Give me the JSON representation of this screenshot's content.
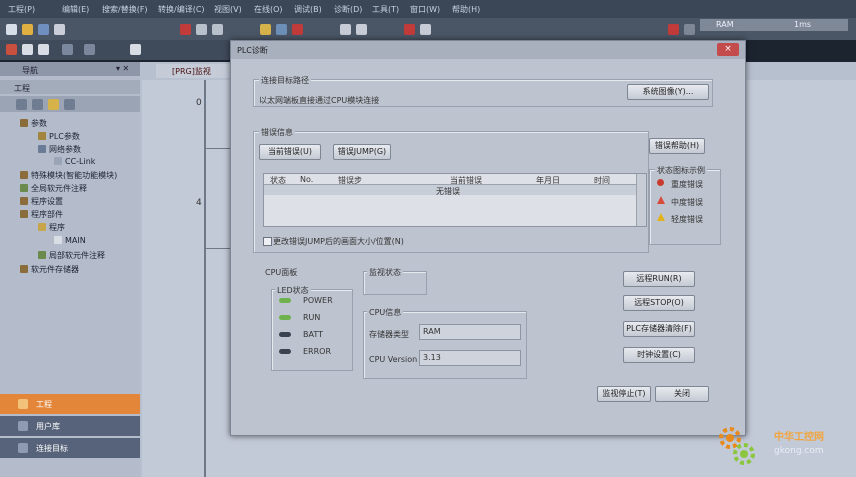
{
  "menu": [
    "工程(P)",
    "编辑(E)",
    "搜索/替换(F)",
    "转换/编译(C)",
    "视图(V)",
    "在线(O)",
    "调试(B)",
    "诊断(D)",
    "工具(T)",
    "窗口(W)",
    "帮助(H)"
  ],
  "status_fields": {
    "memory": "RAM",
    "time": "1ms"
  },
  "navigation": {
    "title": "导航",
    "project_label": "工程",
    "tree": [
      {
        "label": "参数",
        "level": 0
      },
      {
        "label": "PLC参数",
        "level": 1
      },
      {
        "label": "网络参数",
        "level": 1
      },
      {
        "label": "CC-Link",
        "level": 2
      },
      {
        "label": "特殊模块(智能功能模块)",
        "level": 0
      },
      {
        "label": "全局软元件注释",
        "level": 0
      },
      {
        "label": "程序设置",
        "level": 0
      },
      {
        "label": "程序部件",
        "level": 0
      },
      {
        "label": "程序",
        "level": 1
      },
      {
        "label": "MAIN",
        "level": 2
      },
      {
        "label": "局部软元件注释",
        "level": 1
      },
      {
        "label": "软元件存储器",
        "level": 0
      }
    ],
    "bottom_tabs": [
      "工程",
      "用户库",
      "连接目标"
    ]
  },
  "editor": {
    "tab_label": "[PRG]监视",
    "rung_numbers": [
      "0",
      "4"
    ]
  },
  "dialog": {
    "title": "PLC诊断",
    "close_symbol": "×",
    "target_group": {
      "label": "连接目标路径",
      "value": "以太网端板直接通过CPU模块连接",
      "system_button": "系统图像(Y)..."
    },
    "error_group": {
      "label": "错误信息",
      "current_error_button": "当前错误(U)",
      "error_jump_button": "错误JUMP(G)",
      "error_help_button": "错误帮助(H)",
      "table_headers": [
        "状态",
        "No.",
        "错误步",
        "当前错误",
        "年月日",
        "时间"
      ],
      "table_rows": [
        [
          "",
          "",
          "",
          "无错误",
          "",
          ""
        ]
      ],
      "checkbox_label": "更改错误JUMP后的画面大小/位置(N)"
    },
    "status_legend": {
      "label": "状态图标示例",
      "items": [
        {
          "label": "重度错误",
          "color": "#c83a2e"
        },
        {
          "label": "中度错误",
          "color": "#d84a3a"
        },
        {
          "label": "轻度错误",
          "color": "#e3b21a"
        }
      ]
    },
    "cpu_panel": {
      "label": "CPU面板",
      "led_label": "LED状态",
      "leds": [
        {
          "label": "POWER",
          "color": "#6fb24d"
        },
        {
          "label": "RUN",
          "color": "#6fb24d"
        },
        {
          "label": "BATT",
          "color": "#3a4250"
        },
        {
          "label": "ERROR",
          "color": "#3a4250"
        }
      ]
    },
    "monitor_status": {
      "label": "监视状态"
    },
    "cpu_info": {
      "label": "CPU信息",
      "memory_type_label": "存储器类型",
      "memory_type_value": "RAM",
      "version_label": "CPU Version",
      "version_value": "3.13"
    },
    "buttons": {
      "remote_run": "远程RUN(R)",
      "remote_stop": "远程STOP(O)",
      "memory_clear": "PLC存储器清除(F)",
      "clock_setting": "时钟设置(C)",
      "stop_monitor": "监视停止(T)",
      "close": "关闭"
    }
  },
  "watermark": {
    "site": "gkong.com",
    "brand": "中华工控网"
  }
}
